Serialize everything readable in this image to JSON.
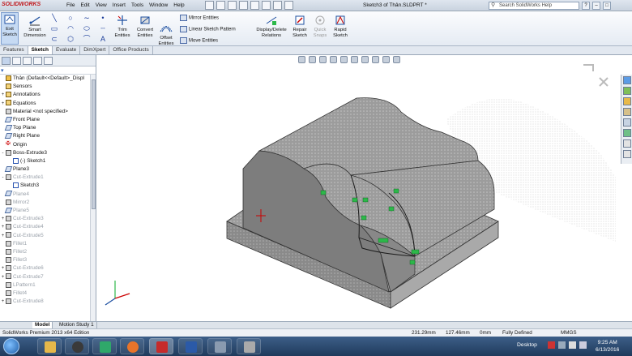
{
  "app": {
    "logo": "SOLIDWORKS",
    "menu": [
      "File",
      "Edit",
      "View",
      "Insert",
      "Tools",
      "Window",
      "Help"
    ],
    "document_title": "Sketch3 of Thân.SLDPRT *",
    "search_placeholder": "Search SolidWorks Help"
  },
  "ribbon": {
    "exit_sketch": [
      "Exit",
      "Sketch"
    ],
    "smart_dimension": [
      "Smart",
      "Dimension"
    ],
    "trim_entities": [
      "Trim",
      "Entities"
    ],
    "convert_entities": [
      "Convert",
      "Entities"
    ],
    "offset_entities": [
      "Offset",
      "Entities"
    ],
    "mirror_entities": "Mirror Entities",
    "linear_sketch_pattern": "Linear Sketch Pattern",
    "move_entities": "Move Entities",
    "display_delete_relations": [
      "Display/Delete",
      "Relations"
    ],
    "repair_sketch": [
      "Repair",
      "Sketch"
    ],
    "quick_snaps": [
      "Quick",
      "Snaps"
    ],
    "rapid_sketch": [
      "Rapid",
      "Sketch"
    ]
  },
  "command_tabs": [
    "Features",
    "Sketch",
    "Evaluate",
    "DimXpert",
    "Office Products"
  ],
  "active_command_tab": "Sketch",
  "tree": [
    {
      "label": "Thân  (Default<<Default>_Displ",
      "kind": "root",
      "exp": "",
      "state": "normal"
    },
    {
      "label": "Sensors",
      "kind": "folder",
      "exp": "",
      "state": "normal"
    },
    {
      "label": "Annotations",
      "kind": "folder",
      "exp": "+",
      "state": "normal"
    },
    {
      "label": "Equations",
      "kind": "folder",
      "exp": "+",
      "state": "normal"
    },
    {
      "label": "Material <not specified>",
      "kind": "feature",
      "exp": "",
      "state": "normal"
    },
    {
      "label": "Front Plane",
      "kind": "plane",
      "exp": "",
      "state": "normal"
    },
    {
      "label": "Top Plane",
      "kind": "plane",
      "exp": "",
      "state": "normal"
    },
    {
      "label": "Right Plane",
      "kind": "plane",
      "exp": "",
      "state": "normal"
    },
    {
      "label": "Origin",
      "kind": "origin",
      "exp": "",
      "state": "normal"
    },
    {
      "label": "Boss-Extrude3",
      "kind": "feature",
      "exp": "-",
      "state": "normal"
    },
    {
      "label": "(-) Sketch1",
      "kind": "sketch",
      "exp": "",
      "state": "normal",
      "indent": true
    },
    {
      "label": "Plane3",
      "kind": "plane",
      "exp": "",
      "state": "normal"
    },
    {
      "label": "Cut-Extrude1",
      "kind": "feature",
      "exp": "-",
      "state": "grey"
    },
    {
      "label": "Sketch3",
      "kind": "sketch",
      "exp": "",
      "state": "normal",
      "indent": true
    },
    {
      "label": "Plane4",
      "kind": "plane",
      "exp": "",
      "state": "grey"
    },
    {
      "label": "Mirror2",
      "kind": "feature",
      "exp": "",
      "state": "grey"
    },
    {
      "label": "Plane5",
      "kind": "plane",
      "exp": "",
      "state": "grey"
    },
    {
      "label": "Cut-Extrude3",
      "kind": "feature",
      "exp": "+",
      "state": "grey"
    },
    {
      "label": "Cut-Extrude4",
      "kind": "feature",
      "exp": "+",
      "state": "grey"
    },
    {
      "label": "Cut-Extrude5",
      "kind": "feature",
      "exp": "+",
      "state": "grey"
    },
    {
      "label": "Fillet1",
      "kind": "feature",
      "exp": "",
      "state": "grey"
    },
    {
      "label": "Fillet2",
      "kind": "feature",
      "exp": "",
      "state": "grey"
    },
    {
      "label": "Fillet3",
      "kind": "feature",
      "exp": "",
      "state": "grey"
    },
    {
      "label": "Cut-Extrude6",
      "kind": "feature",
      "exp": "+",
      "state": "grey"
    },
    {
      "label": "Cut-Extrude7",
      "kind": "feature",
      "exp": "+",
      "state": "grey"
    },
    {
      "label": "LPattern1",
      "kind": "feature",
      "exp": "",
      "state": "grey"
    },
    {
      "label": "Fillet4",
      "kind": "feature",
      "exp": "",
      "state": "grey"
    },
    {
      "label": "Cut-Extrude8",
      "kind": "feature",
      "exp": "+",
      "state": "grey"
    }
  ],
  "bottom_tabs": [
    "Model",
    "Motion Study 1"
  ],
  "status": {
    "edition": "SolidWorks Premium 2013 x64 Edition",
    "x": "231.29mm",
    "y": "127.46mm",
    "z": "0mm",
    "state": "Fully Defined",
    "units": "MMGS"
  },
  "taskbar": {
    "desktop": "Desktop",
    "time": "9:25 AM",
    "date": "6/13/2016"
  },
  "colors": {
    "sketch_relation": "#2db84a",
    "origin": "#cc0000",
    "part_grey": "#8f8f8f"
  }
}
